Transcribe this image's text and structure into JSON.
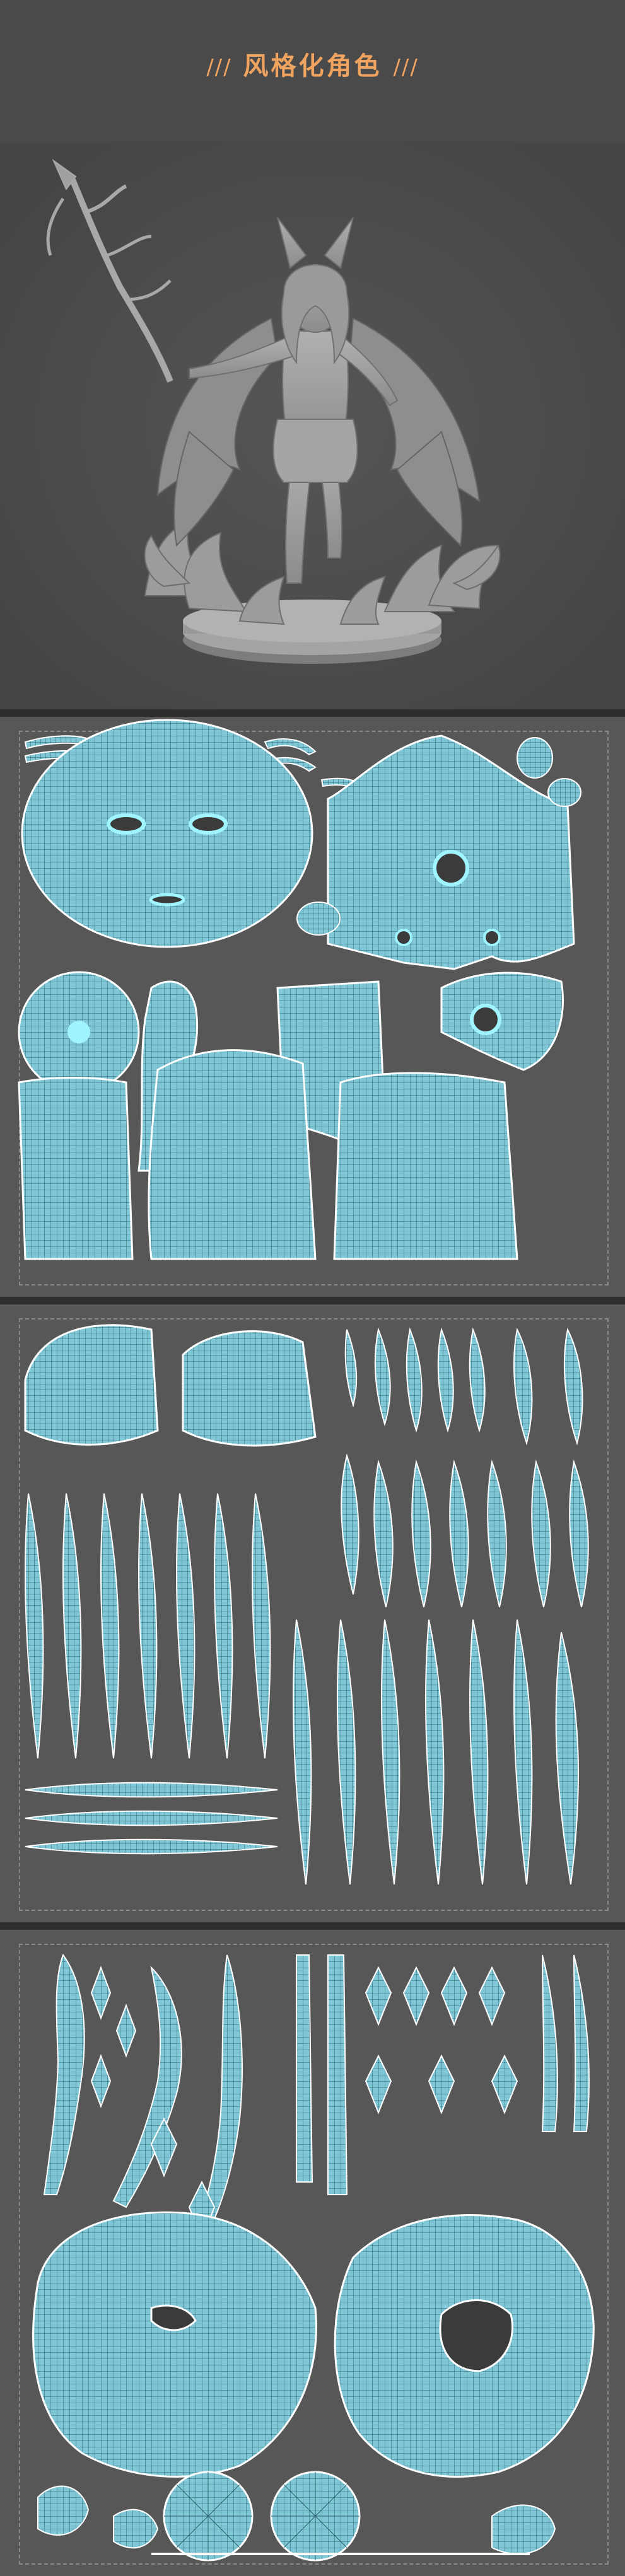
{
  "header": {
    "title_prefix": "///",
    "title_text": "风格化角色",
    "title_suffix": "///",
    "accent_color": "#f0a460"
  },
  "render": {
    "background": "#4c4c4c",
    "model_color": "#9a9a9a"
  },
  "uv": {
    "island_fill": "#7fc7d6",
    "island_line": "#1f4f5a",
    "panel_bg": "#575757",
    "seam_color": "#ffffff",
    "highlight_color": "#7ff0ff",
    "panels": [
      {
        "label": ""
      },
      {
        "label": ""
      },
      {
        "label": ""
      }
    ]
  }
}
